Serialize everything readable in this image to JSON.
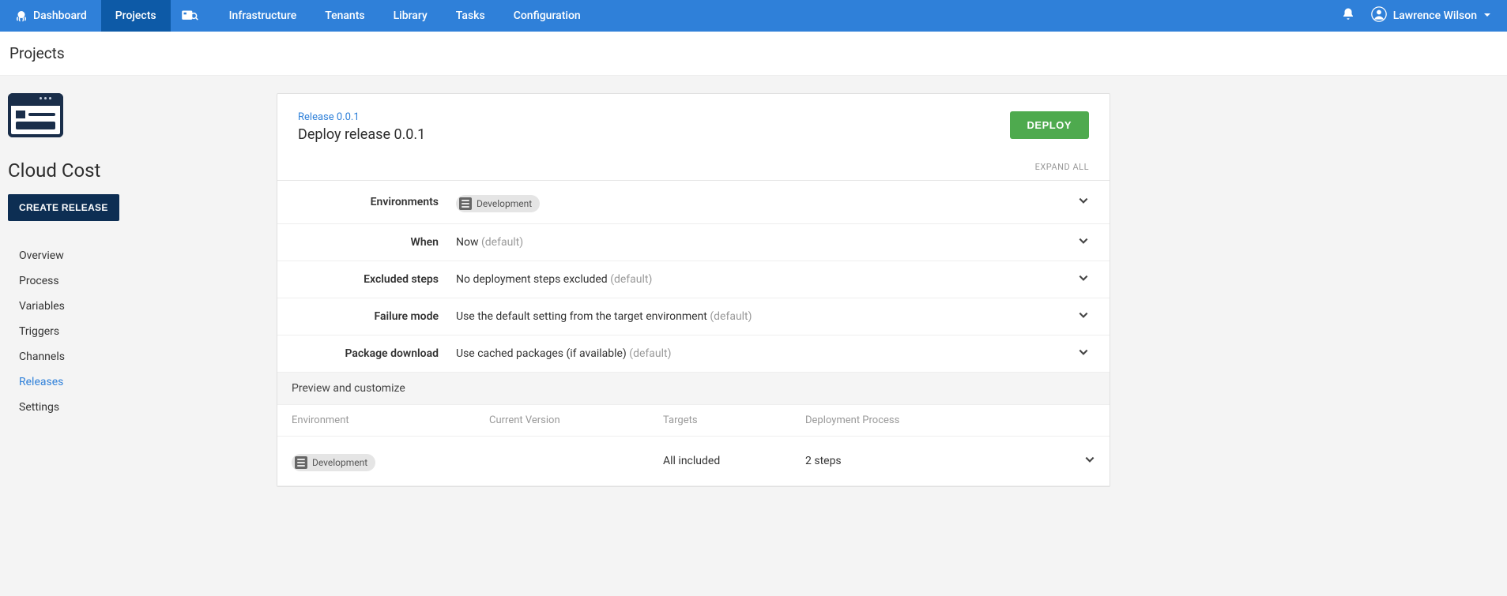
{
  "nav": {
    "items": [
      {
        "label": "Dashboard",
        "active": false,
        "icon": "octopus"
      },
      {
        "label": "Projects",
        "active": true
      },
      {
        "label": "",
        "active": false,
        "icon": "search"
      },
      {
        "label": "Infrastructure",
        "active": false
      },
      {
        "label": "Tenants",
        "active": false
      },
      {
        "label": "Library",
        "active": false
      },
      {
        "label": "Tasks",
        "active": false
      },
      {
        "label": "Configuration",
        "active": false
      }
    ],
    "user": "Lawrence Wilson"
  },
  "subheader": {
    "title": "Projects"
  },
  "sidebar": {
    "project_name": "Cloud Cost",
    "create_btn": "CREATE RELEASE",
    "menu": [
      {
        "label": "Overview",
        "active": false
      },
      {
        "label": "Process",
        "active": false
      },
      {
        "label": "Variables",
        "active": false
      },
      {
        "label": "Triggers",
        "active": false
      },
      {
        "label": "Channels",
        "active": false
      },
      {
        "label": "Releases",
        "active": true
      },
      {
        "label": "Settings",
        "active": false
      }
    ]
  },
  "panel": {
    "release_link": "Release 0.0.1",
    "title": "Deploy release 0.0.1",
    "deploy_btn": "DEPLOY",
    "expand_all": "EXPAND ALL",
    "rows": {
      "environments": {
        "label": "Environments",
        "chip": "Development"
      },
      "when": {
        "label": "When",
        "value": "Now ",
        "suffix": "(default)"
      },
      "excluded": {
        "label": "Excluded steps",
        "value": "No deployment steps excluded ",
        "suffix": "(default)"
      },
      "failure": {
        "label": "Failure mode",
        "value": "Use the default setting from the target environment ",
        "suffix": "(default)"
      },
      "package": {
        "label": "Package download",
        "value": "Use cached packages (if available) ",
        "suffix": "(default)"
      }
    },
    "preview": {
      "header": "Preview and customize",
      "cols": {
        "env": "Environment",
        "ver": "Current Version",
        "tgt": "Targets",
        "proc": "Deployment Process"
      },
      "row": {
        "env_chip": "Development",
        "ver": "",
        "tgt": "All included",
        "proc": "2 steps"
      }
    }
  }
}
